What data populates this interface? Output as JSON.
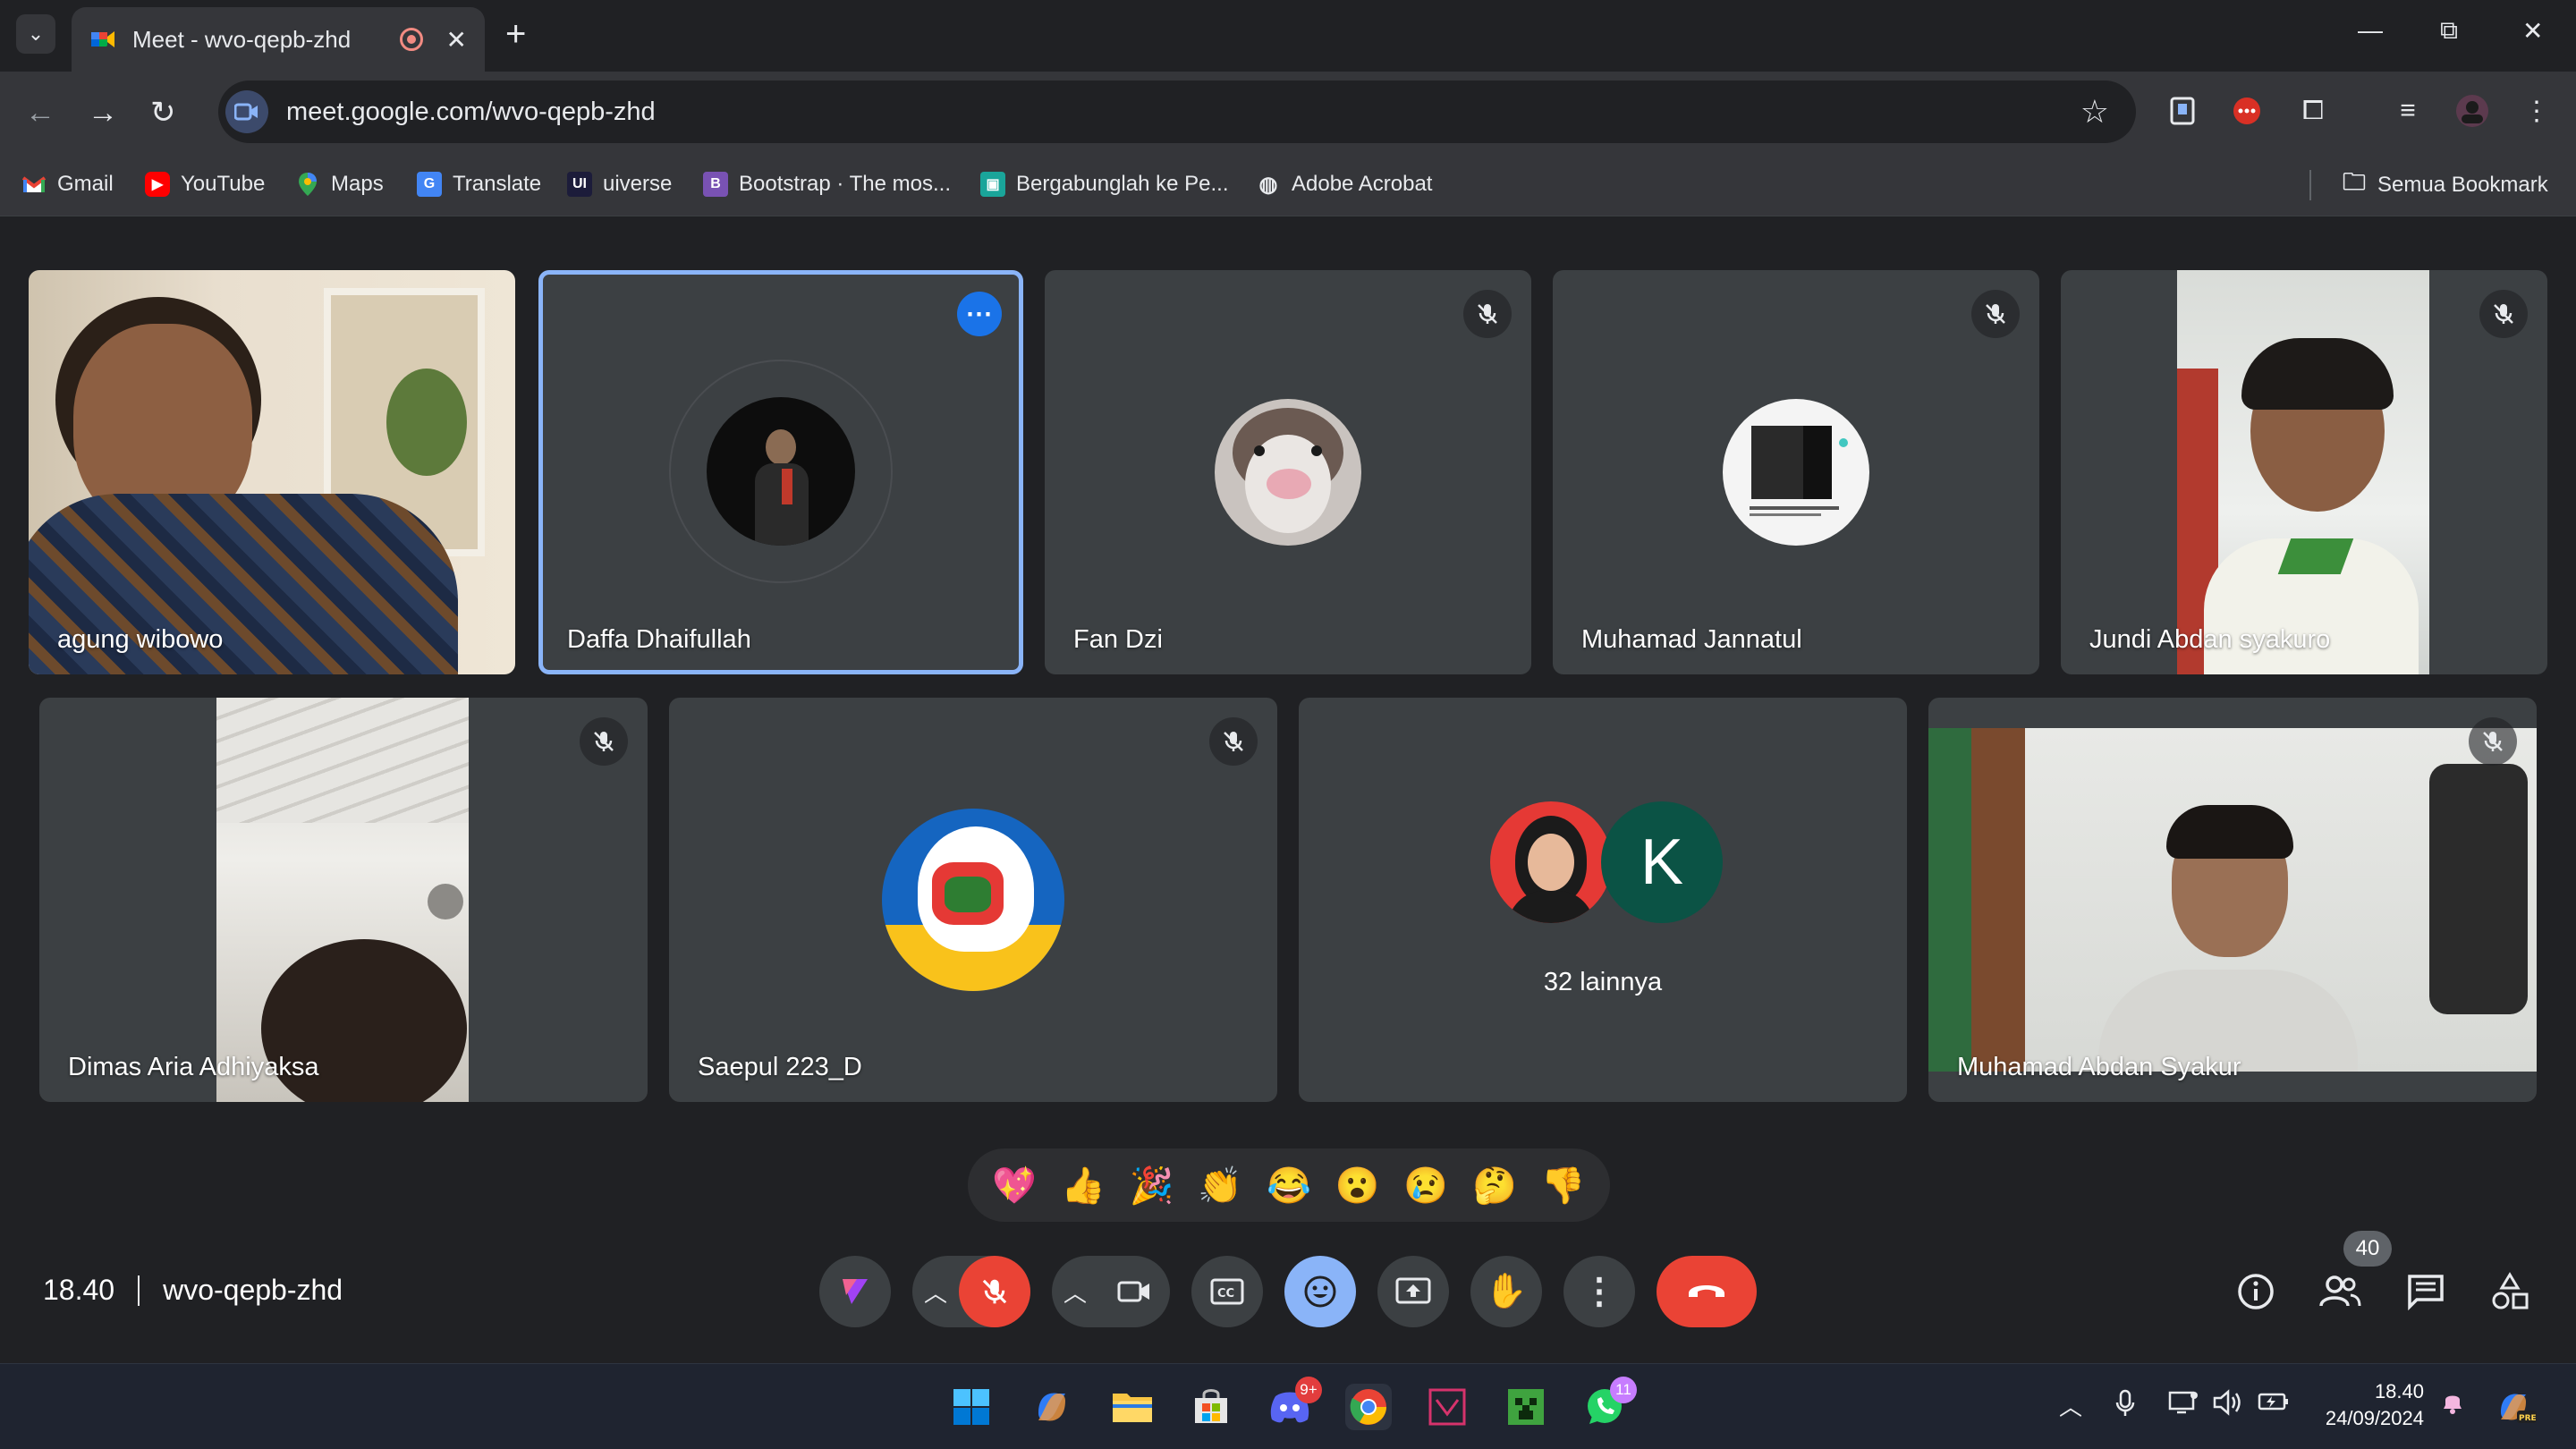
{
  "browser": {
    "tab_title": "Meet - wvo-qepb-zhd",
    "url": "meet.google.com/wvo-qepb-zhd",
    "bookmarks": [
      "Gmail",
      "YouTube",
      "Maps",
      "Translate",
      "uiverse",
      "Bootstrap · The mos...",
      "Bergabunglah ke Pe...",
      "Adobe Acrobat"
    ],
    "all_bookmarks": "Semua Bookmark"
  },
  "meet": {
    "participants": [
      {
        "name": "agung wibowo",
        "muted": false,
        "type": "video"
      },
      {
        "name": "Daffa Dhaifullah",
        "muted": false,
        "type": "avatar",
        "active": true
      },
      {
        "name": "Fan Dzi",
        "muted": true,
        "type": "avatar"
      },
      {
        "name": "Muhamad Jannatul",
        "muted": true,
        "type": "avatar"
      },
      {
        "name": "Jundi Abdan syakuro",
        "muted": true,
        "type": "video"
      },
      {
        "name": "Dimas Aria Adhiyaksa",
        "muted": true,
        "type": "video"
      },
      {
        "name": "Saepul 223_D",
        "muted": true,
        "type": "avatar"
      },
      {
        "name": "Muhamad Abdan Syakur",
        "muted": true,
        "type": "video"
      }
    ],
    "others_tile": {
      "label": "32 lainnya",
      "initial": "K"
    },
    "reactions": [
      "💖",
      "👍",
      "🎉",
      "👏",
      "😂",
      "😮",
      "😢",
      "🤔",
      "👎"
    ],
    "time": "18.40",
    "meeting_code": "wvo-qepb-zhd",
    "participant_count": "40"
  },
  "taskbar": {
    "discord_badge": "9+",
    "whatsapp_badge": "11",
    "time": "18.40",
    "date": "24/09/2024"
  },
  "colors": {
    "meet_bg": "#202124",
    "tile_bg": "#3c4043",
    "active_outline": "#8ab4f8",
    "end_call": "#ea4335"
  }
}
